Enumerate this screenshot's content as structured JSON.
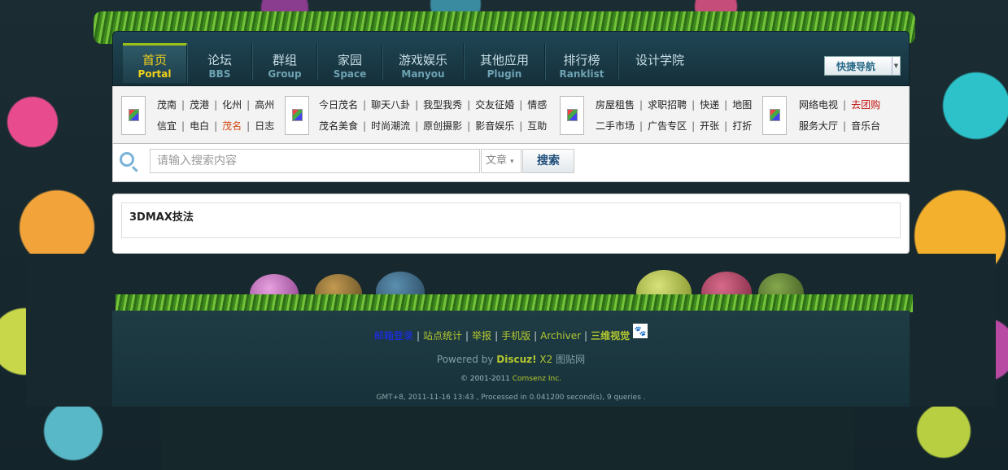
{
  "nav": {
    "items": [
      {
        "cn": "首页",
        "en": "Portal"
      },
      {
        "cn": "论坛",
        "en": "BBS"
      },
      {
        "cn": "群组",
        "en": "Group"
      },
      {
        "cn": "家园",
        "en": "Space"
      },
      {
        "cn": "游戏娱乐",
        "en": "Manyou"
      },
      {
        "cn": "其他应用",
        "en": "Plugin"
      },
      {
        "cn": "排行榜",
        "en": "Ranklist"
      },
      {
        "cn": "设计学院",
        "en": ""
      }
    ],
    "quick_nav": "快捷导航"
  },
  "links": {
    "group1": {
      "row1": [
        "茂南",
        "茂港",
        "化州",
        "高州"
      ],
      "row2": [
        "信宜",
        "电白",
        "茂名",
        "日志"
      ]
    },
    "group2": {
      "row1": [
        "今日茂名",
        "聊天八卦",
        "我型我秀",
        "交友征婚",
        "情感"
      ],
      "row2": [
        "茂名美食",
        "时尚潮流",
        "原创摄影",
        "影音娱乐",
        "互助"
      ]
    },
    "group3": {
      "row1": [
        "房屋租售",
        "求职招聘",
        "快递",
        "地图"
      ],
      "row2": [
        "二手市场",
        "广告专区",
        "开张",
        "打折"
      ]
    },
    "group4": {
      "row1": [
        "网络电视",
        "去团购"
      ],
      "row2": [
        "服务大厅",
        "音乐台"
      ]
    }
  },
  "search": {
    "placeholder": "请输入搜索内容",
    "type": "文章",
    "button": "搜索"
  },
  "content": {
    "title": "3DMAX技法"
  },
  "footer": {
    "links": [
      "邮箱登录",
      "站点统计",
      "举报",
      "手机版",
      "Archiver",
      "三维视觉"
    ],
    "paw": "🐾",
    "powered_prefix": "Powered by ",
    "powered_brand": "Discuz!",
    "powered_version": " X2",
    "powered_site": " 图贴网",
    "copyright_prefix": "© 2001-2011 ",
    "copyright_company": "Comsenz Inc.",
    "gmt": "GMT+8, 2011-11-16 13:43 , Processed in 0.041200 second(s), 9 queries ."
  }
}
